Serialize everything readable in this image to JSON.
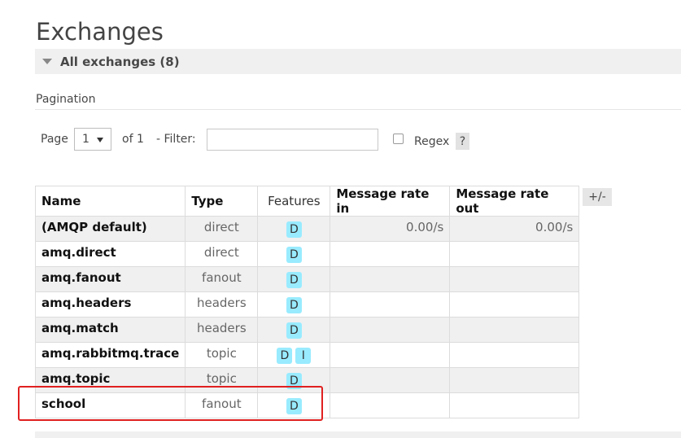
{
  "page_title": "Exchanges",
  "section_header": "All exchanges (8)",
  "pagination": {
    "label": "Pagination",
    "page_label": "Page",
    "page_value": "1",
    "of_label": "of 1",
    "filter_label": "- Filter:",
    "filter_value": "",
    "regex_label": "Regex",
    "help_label": "?"
  },
  "table": {
    "columns": [
      "Name",
      "Type",
      "Features",
      "Message rate in",
      "Message rate out"
    ],
    "toggle_columns_label": "+/-",
    "rows": [
      {
        "name": "(AMQP default)",
        "type": "direct",
        "features": [
          "D"
        ],
        "rate_in": "0.00/s",
        "rate_out": "0.00/s"
      },
      {
        "name": "amq.direct",
        "type": "direct",
        "features": [
          "D"
        ],
        "rate_in": "",
        "rate_out": ""
      },
      {
        "name": "amq.fanout",
        "type": "fanout",
        "features": [
          "D"
        ],
        "rate_in": "",
        "rate_out": ""
      },
      {
        "name": "amq.headers",
        "type": "headers",
        "features": [
          "D"
        ],
        "rate_in": "",
        "rate_out": ""
      },
      {
        "name": "amq.match",
        "type": "headers",
        "features": [
          "D"
        ],
        "rate_in": "",
        "rate_out": ""
      },
      {
        "name": "amq.rabbitmq.trace",
        "type": "topic",
        "features": [
          "D",
          "I"
        ],
        "rate_in": "",
        "rate_out": ""
      },
      {
        "name": "amq.topic",
        "type": "topic",
        "features": [
          "D"
        ],
        "rate_in": "",
        "rate_out": ""
      },
      {
        "name": "school",
        "type": "fanout",
        "features": [
          "D"
        ],
        "rate_in": "",
        "rate_out": ""
      }
    ]
  },
  "colors": {
    "badge": "#99ebff",
    "highlight_border": "#e02020",
    "alt_row": "#f0f0f0"
  }
}
